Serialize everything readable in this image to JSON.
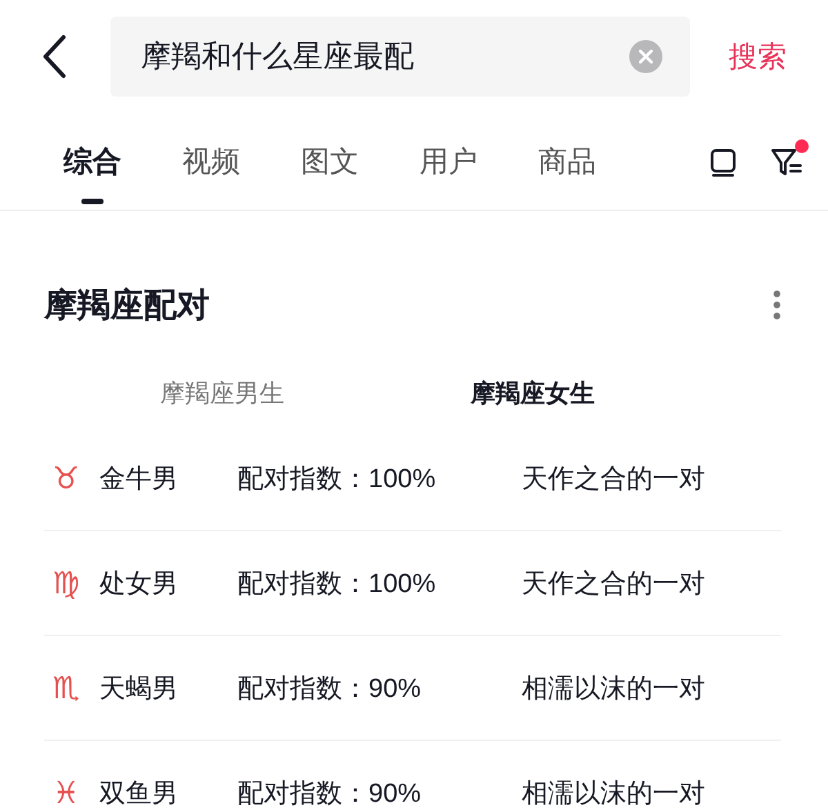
{
  "search": {
    "value": "摩羯和什么星座最配",
    "submit": "搜索"
  },
  "tabs": [
    {
      "label": "综合",
      "selected": true
    },
    {
      "label": "视频",
      "selected": false
    },
    {
      "label": "图文",
      "selected": false
    },
    {
      "label": "用户",
      "selected": false
    },
    {
      "label": "商品",
      "selected": false
    }
  ],
  "filter": {
    "badge": true
  },
  "card": {
    "title": "摩羯座配对",
    "columns": [
      {
        "label": "摩羯座男生",
        "selected": false
      },
      {
        "label": "摩羯座女生",
        "selected": true
      }
    ],
    "rows": [
      {
        "sign": "♉",
        "name": "金牛男",
        "score": "配对指数：100%",
        "verdict": "天作之合的一对"
      },
      {
        "sign": "♍",
        "name": "处女男",
        "score": "配对指数：100%",
        "verdict": "天作之合的一对"
      },
      {
        "sign": "♏",
        "name": "天蝎男",
        "score": "配对指数：90%",
        "verdict": "相濡以沫的一对"
      },
      {
        "sign": "♓",
        "name": "双鱼男",
        "score": "配对指数：90%",
        "verdict": "相濡以沫的一对"
      }
    ]
  }
}
